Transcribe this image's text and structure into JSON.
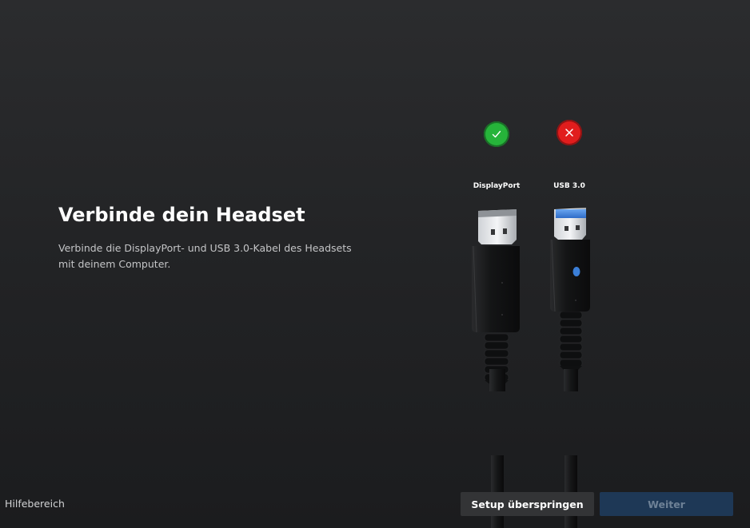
{
  "page": {
    "title": "Verbinde dein Headset",
    "description": "Verbinde die DisplayPort- und USB 3.0-Kabel des Headsets mit deinem Computer."
  },
  "connections": [
    {
      "label": "DisplayPort",
      "status": "connected",
      "status_icon": "check-icon",
      "status_color": "#26b43a"
    },
    {
      "label": "USB 3.0",
      "status": "disconnected",
      "status_icon": "close-icon",
      "status_color": "#e11d1d"
    }
  ],
  "footer": {
    "help_link": "Hilfebereich",
    "skip_button": "Setup überspringen",
    "next_button": "Weiter"
  },
  "colors": {
    "usb_accent": "#3b7fd8",
    "next_button_bg": "#1e3856"
  }
}
